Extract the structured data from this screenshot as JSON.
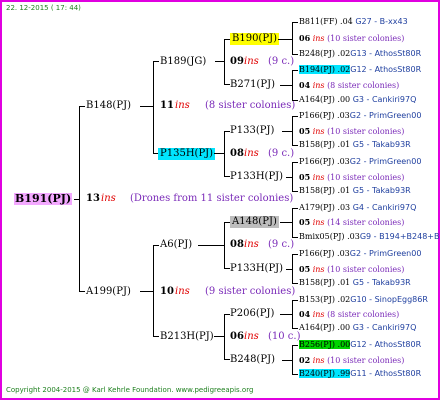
{
  "header": "22. 12-2015 ( 17: 44)",
  "footer": "Copyright 2004-2015 @ Karl Kehrle Foundation.   www.pedigreeapis.org",
  "root": {
    "id": "B191(PJ)",
    "gen": "13",
    "ins": "ins",
    "note": "(Drones from 11 sister colonies)"
  },
  "g1": {
    "top": {
      "id": "B148(PJ)",
      "gen": "11",
      "ins": "ins",
      "note": "(8 sister colonies)"
    },
    "bottom": {
      "id": "A199(PJ)",
      "gen": "10",
      "ins": "ins",
      "note": "(9 sister colonies)"
    }
  },
  "g2": {
    "a": {
      "id": "B189(JG)",
      "gen": "09",
      "ins": "ins",
      "note": "(9 c.)"
    },
    "b": {
      "id": "P135H(PJ)",
      "gen": "08",
      "ins": "ins",
      "note": "(9 c.)"
    },
    "c": {
      "id": "A6(PJ)",
      "gen": "08",
      "ins": "ins",
      "note": "(9 c.)"
    },
    "d": {
      "id": "B213H(PJ)",
      "gen": "06",
      "ins": "ins",
      "note": "(10 c.)"
    }
  },
  "g3": {
    "a1": {
      "id": "B190(PJ)"
    },
    "a2": {
      "id": "B271(PJ)"
    },
    "b1": {
      "id": "P133(PJ)"
    },
    "b2": {
      "id": "P133H(PJ)"
    },
    "c1": {
      "id": "A148(PJ)"
    },
    "c2": {
      "id": "P133H(PJ)"
    },
    "d1": {
      "id": "P206(PJ)"
    },
    "d2": {
      "id": "B248(PJ)"
    }
  },
  "g4": [
    {
      "top": "B811(FF) .04",
      "topm": "G27 - B-xx43",
      "mid": "06",
      "ins": "ins",
      "note": "(10 sister colonies)",
      "bot": "B248(PJ) .02",
      "botm": "G13 - AthosSt80R"
    },
    {
      "top": "B194(PJ) .02",
      "topm": "G12 - AthosSt80R",
      "mid": "04",
      "ins": "ins",
      "note": "(8 sister colonies)",
      "bot": "A164(PJ) .00",
      "botm": "G3 - Cankiri97Q"
    },
    {
      "top": "P166(PJ) .03",
      "topm": "G2 - PrimGreen00",
      "mid": "05",
      "ins": "ins",
      "note": "(10 sister colonies)",
      "bot": "B158(PJ) .01",
      "botm": "G5 - Takab93R"
    },
    {
      "top": "P166(PJ) .03",
      "topm": "G2 - PrimGreen00",
      "mid": "05",
      "ins": "ins",
      "note": "(10 sister colonies)",
      "bot": "B158(PJ) .01",
      "botm": "G5 - Takab93R"
    },
    {
      "top": "A179(PJ) .03",
      "topm": "G4 - Cankiri97Q",
      "mid": "05",
      "ins": "ins",
      "note": "(14 sister colonies)",
      "bot": "Bmix05(PJ) .03",
      "botm": "G9 - B194+B248+B"
    },
    {
      "top": "P166(PJ) .03",
      "topm": "G2 - PrimGreen00",
      "mid": "05",
      "ins": "ins",
      "note": "(10 sister colonies)",
      "bot": "B158(PJ) .01",
      "botm": "G5 - Takab93R"
    },
    {
      "top": "B153(PJ) .02",
      "topm": "G10 - SinopEgg86R",
      "mid": "04",
      "ins": "ins",
      "note": "(8 sister colonies)",
      "bot": "A164(PJ) .00",
      "botm": "G3 - Cankiri97Q"
    },
    {
      "top": "B256(PJ) .00",
      "topm": "G12 - AthosSt80R",
      "mid": "02",
      "ins": "ins",
      "note": "(10 sister colonies)",
      "bot": "B240(PJ) .99",
      "botm": "G11 - AthosSt80R"
    }
  ]
}
